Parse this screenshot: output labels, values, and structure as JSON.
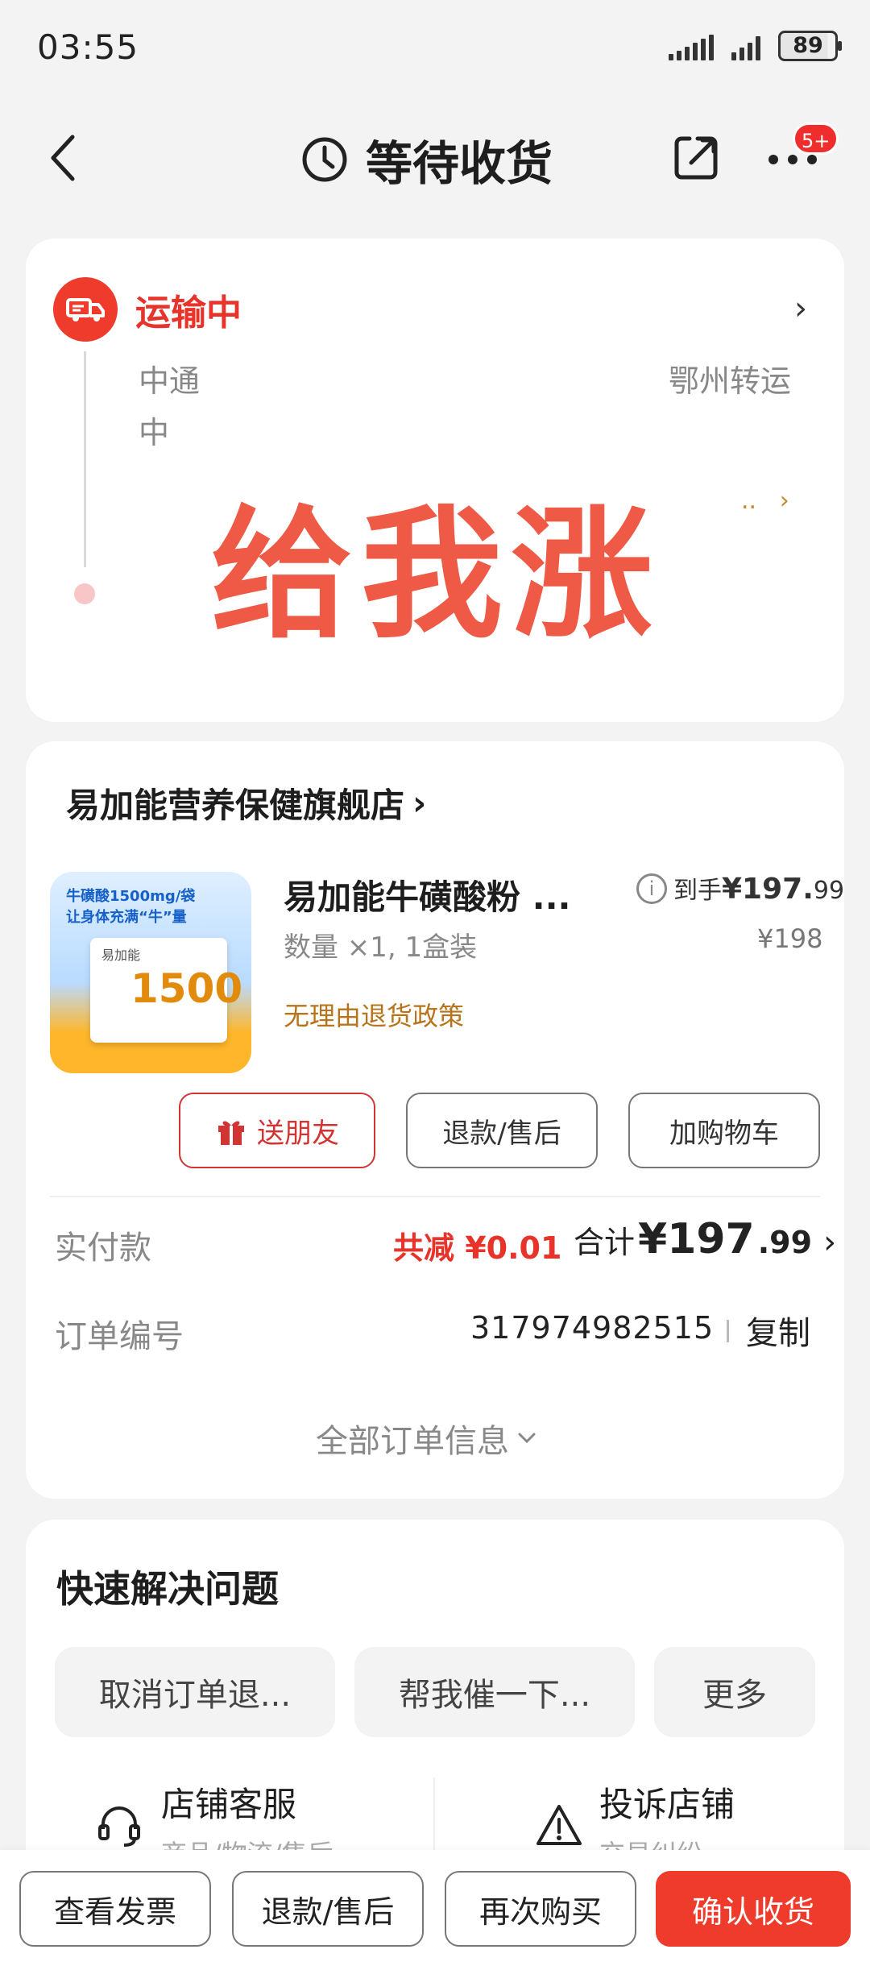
{
  "status_bar": {
    "time": "03:55",
    "battery": "89"
  },
  "header": {
    "title": "等待收货",
    "badge": "5+"
  },
  "logistics": {
    "status": "运输中",
    "line1_left": "中通",
    "line1_right": "鄂州转运",
    "line2": "中",
    "more_hint": "..",
    "overlay_text": "给我涨"
  },
  "order": {
    "shop_name": "易加能营养保健旗舰店",
    "product": {
      "image_text1": "牛磺酸1500mg/袋",
      "image_text2": "让身体充满“牛”量",
      "image_brand": "易加能",
      "image_number": "1500",
      "title": "易加能牛磺酸粉 ...",
      "qty": "数量 ×1, 1盒装",
      "policy": "无理由退货政策",
      "final_label": "到手",
      "final_price_main": "¥197.",
      "final_price_dec": "99",
      "orig_price": "¥198"
    },
    "buttons": {
      "gift": "送朋友",
      "refund": "退款/售后",
      "cart": "加购物车"
    },
    "paid_label": "实付款",
    "discount": "共减 ¥0.01",
    "total_label": "合计",
    "total_main": "¥197",
    "total_dec": ".99",
    "order_no_label": "订单编号",
    "order_no": "317974982515",
    "copy": "复制",
    "all_info": "全部订单信息"
  },
  "quick": {
    "title": "快速解决问题",
    "chips": [
      "取消订单退...",
      "帮我催一下...",
      "更多"
    ],
    "services": [
      {
        "label": "店铺客服",
        "sub": "商品/物流/售后"
      },
      {
        "label": "投诉店铺",
        "sub": "交易纠纷"
      }
    ]
  },
  "bottom_bar": {
    "invoice": "查看发票",
    "refund": "退款/售后",
    "rebuy": "再次购买",
    "confirm": "确认收货"
  },
  "colors": {
    "accent": "#ee3b2c",
    "policy": "#b8741a"
  }
}
